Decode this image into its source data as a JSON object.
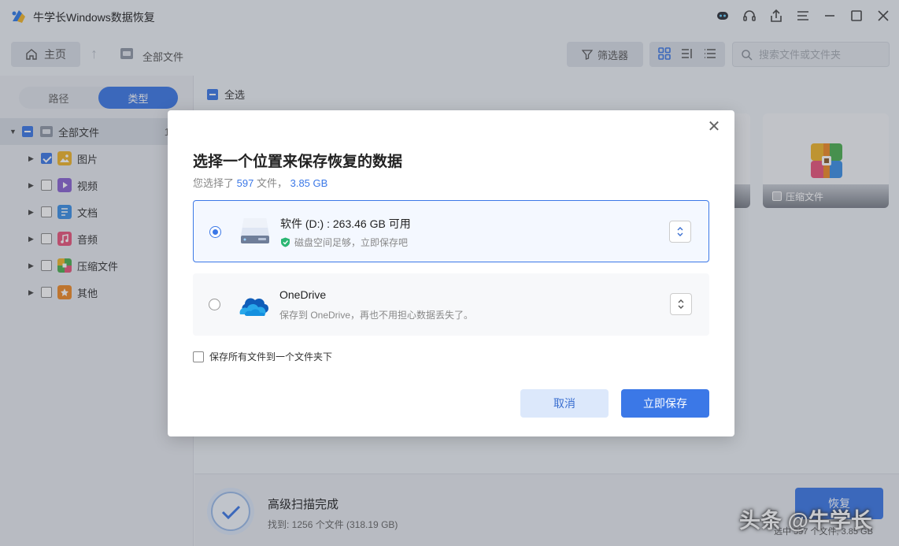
{
  "app": {
    "title": "牛学长Windows数据恢复"
  },
  "titlebar": {
    "icons": [
      "robot-icon",
      "headset-icon",
      "share-icon",
      "menu-icon",
      "minimize-icon",
      "maximize-icon",
      "close-icon"
    ]
  },
  "toolbar": {
    "home_label": "主页",
    "breadcrumb_label": "全部文件",
    "filter_label": "筛选器",
    "search_placeholder": "搜索文件或文件夹"
  },
  "sidebar": {
    "tabs": [
      {
        "label": "路径",
        "active": false
      },
      {
        "label": "类型",
        "active": true
      }
    ],
    "tree": {
      "root": {
        "label": "全部文件",
        "count": "1",
        "state": "mixed"
      },
      "items": [
        {
          "label": "图片",
          "state": "checked",
          "icon": "image-icon",
          "color": "#f0b429"
        },
        {
          "label": "视频",
          "state": "unchecked",
          "icon": "video-icon",
          "color": "#8a63d2"
        },
        {
          "label": "文档",
          "state": "unchecked",
          "icon": "document-icon",
          "color": "#3b8fe7"
        },
        {
          "label": "音频",
          "state": "unchecked",
          "icon": "audio-icon",
          "color": "#e9547a"
        },
        {
          "label": "压缩文件",
          "state": "unchecked",
          "icon": "archive-icon",
          "color": "#4caf50"
        },
        {
          "label": "其他",
          "state": "unchecked",
          "icon": "other-icon",
          "color": "#f08a24"
        }
      ]
    }
  },
  "main": {
    "select_all_label": "全选",
    "cards": [
      {
        "label": "压缩文件",
        "icon": "archive-icon"
      }
    ]
  },
  "statusbar": {
    "scan_title": "高级扫描完成",
    "scan_sub": "找到: 1256 个文件 (318.19 GB)",
    "recover_label": "恢复",
    "selected_info": "选中 597 个文件, 3.85 GB",
    "watermark": "头条 @牛学长"
  },
  "dialog": {
    "title": "选择一个位置来保存恢复的数据",
    "sub_prefix": "您选择了",
    "sub_count": "597",
    "sub_mid": "文件，",
    "sub_size": "3.85 GB",
    "options": [
      {
        "name": "软件 (D:) : 263.46 GB 可用",
        "desc": "磁盘空间足够，立即保存吧",
        "selected": true,
        "icon": "hard-drive-icon"
      },
      {
        "name": "OneDrive",
        "desc": "保存到 OneDrive，再也不用担心数据丢失了。",
        "selected": false,
        "icon": "onedrive-icon"
      }
    ],
    "folder_checkbox_label": "保存所有文件到一个文件夹下",
    "cancel_label": "取消",
    "save_label": "立即保存"
  },
  "colors": {
    "accent": "#3b78e7",
    "check_green": "#2bb673"
  }
}
